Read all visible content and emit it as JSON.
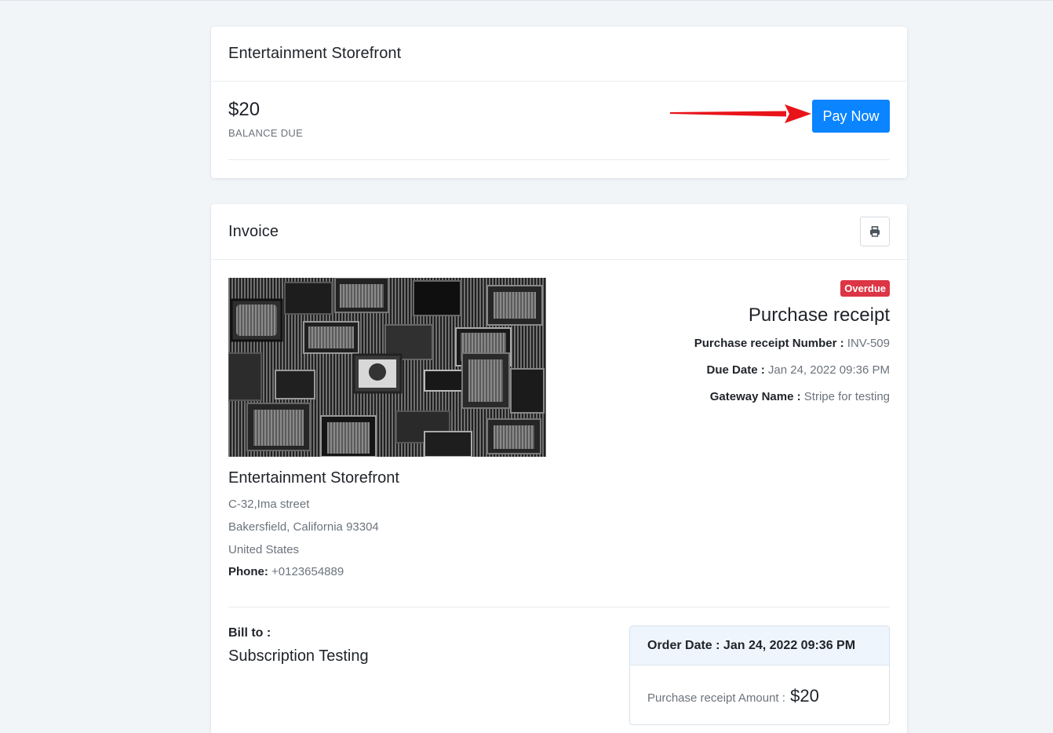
{
  "top_card": {
    "store_name": "Entertainment Storefront",
    "balance_amount": "$20",
    "balance_label": "BALANCE DUE",
    "pay_button": "Pay Now"
  },
  "invoice": {
    "title": "Invoice",
    "print_icon": "printer-icon",
    "status_badge": "Overdue",
    "receipt_title": "Purchase receipt",
    "number_label": "Purchase receipt Number :",
    "number_value": "INV-509",
    "due_label": "Due Date :",
    "due_value": "Jan 24, 2022 09:36 PM",
    "gateway_label": "Gateway Name :",
    "gateway_value": "Stripe for testing"
  },
  "store": {
    "name": "Entertainment Storefront",
    "address_line1": "C-32,Ima street",
    "address_line2": "Bakersfield, California 93304",
    "country": "United States",
    "phone_label": "Phone:",
    "phone_value": "+0123654889"
  },
  "bill_to": {
    "label": "Bill to :",
    "name": "Subscription Testing"
  },
  "order": {
    "date_label": "Order Date :",
    "date_value": "Jan 24, 2022 09:36 PM",
    "amount_label": "Purchase receipt Amount :",
    "amount_value": "$20"
  },
  "colors": {
    "primary": "#0a84ff",
    "danger": "#dc3545",
    "annotation_arrow": "#e8141a"
  }
}
